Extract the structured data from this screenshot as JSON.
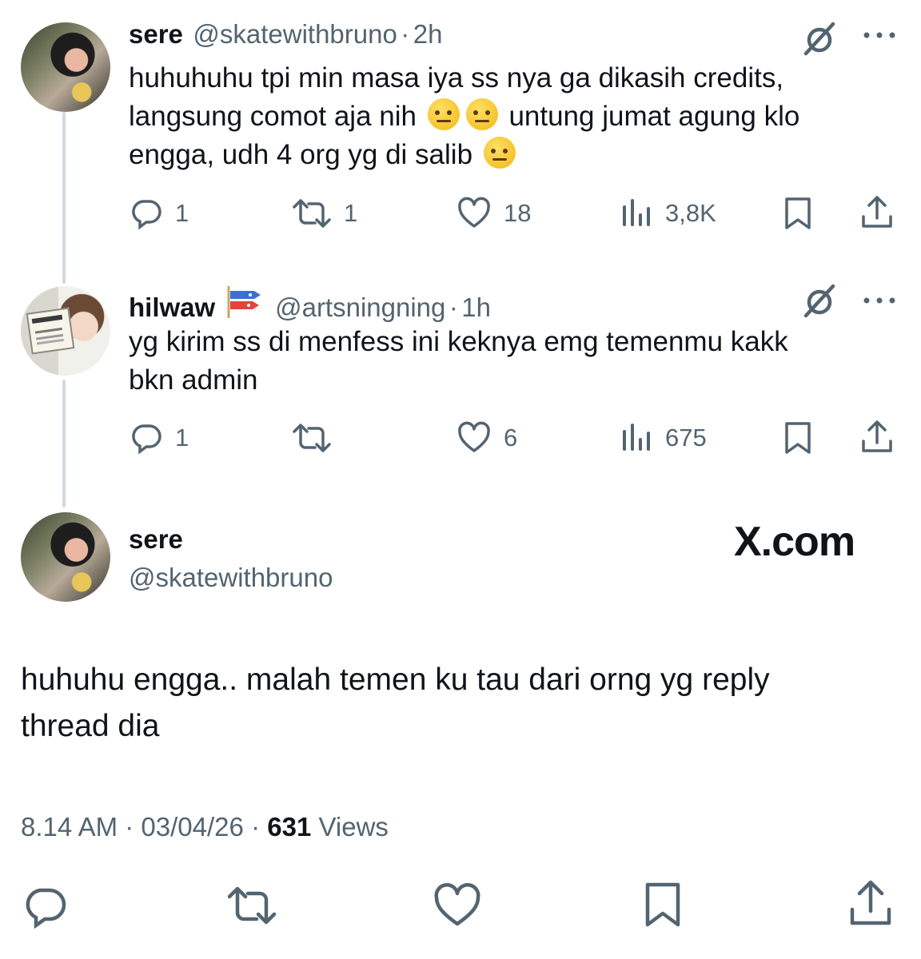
{
  "reply1": {
    "name": "sere",
    "handle": "@skatewithbruno",
    "time": "2h",
    "text_line1": "huhuhuhu tpi min masa iya ss nya ga dikasih credits,",
    "text_line2a": "langsung comot aja nih",
    "text_line2b": "untung jumat agung klo",
    "text_line3": "engga, udh 4 org yg di salib",
    "emoji": "raised-eyebrow-emoji",
    "replies": "1",
    "reposts": "1",
    "likes": "18",
    "views": "3,8K"
  },
  "reply2": {
    "name": "hilwaw",
    "handle": "@artsningning",
    "time": "1h",
    "text_line1": "yg kirim ss di menfess ini keknya emg temenmu kakk",
    "text_line2": "bkn admin",
    "replies": "1",
    "reposts": "",
    "likes": "6",
    "views": "675"
  },
  "main": {
    "name": "sere",
    "handle": "@skatewithbruno",
    "brand": "X.com",
    "text_line1": "huhuhu engga.. malah temen ku tau dari orng yg reply",
    "text_line2": "thread dia",
    "time": "8.14 AM",
    "date": "03/04/26",
    "views_count": "631",
    "views_label": "Views"
  },
  "separator": "·",
  "icons": [
    "reply-icon",
    "repost-icon",
    "like-icon",
    "views-icon",
    "bookmark-icon",
    "share-icon",
    "grok-icon",
    "more-icon"
  ],
  "colors": {
    "text": "#0f1419",
    "secondary": "#536471",
    "thread_line": "#cfd9de"
  }
}
